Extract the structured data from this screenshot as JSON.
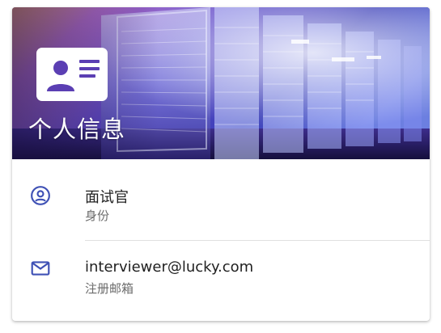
{
  "card": {
    "title": "个人信息",
    "icon": "id-card-icon"
  },
  "items": [
    {
      "icon": "account-circle-icon",
      "primary": "面试官",
      "secondary": "身份"
    },
    {
      "icon": "mail-icon",
      "primary": "interviewer@lucky.com",
      "secondary": "注册邮箱"
    }
  ],
  "colors": {
    "accent": "#3f51b5",
    "hero_dark": "#2a1f6b",
    "hero_light": "#c7d4ff",
    "text_primary": "#1f1f1f",
    "text_secondary": "#6b6b6b"
  }
}
